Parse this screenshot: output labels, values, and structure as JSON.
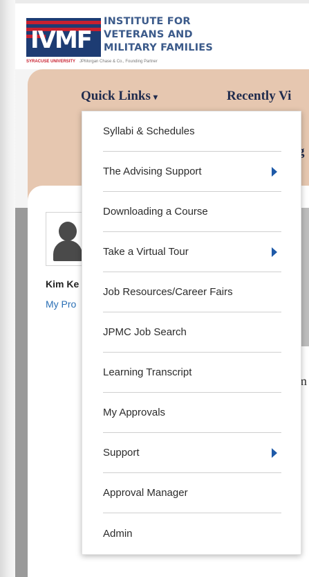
{
  "logo": {
    "mark_text": "IVMF",
    "name_line1": "INSTITUTE FOR",
    "name_line2": "VETERANS AND",
    "name_line3": "MILITARY FAMILIES",
    "footer_university": "SYRACUSE UNIVERSITY",
    "footer_partner": "JPMorgan Chase & Co., Founding Partner",
    "colors": {
      "navy": "#1d3c73",
      "red": "#c8202f"
    }
  },
  "nav": {
    "quick_links": "Quick Links",
    "quick_links_caret": "▾",
    "recently_viewed": "Recently Vi",
    "partial_second_row": "g",
    "bg_color": "#e6c7b0"
  },
  "profile": {
    "name": "Kim Ke",
    "link": "My Pro",
    "icon": "user-silhouette-icon"
  },
  "background_peek": "m",
  "menu": {
    "items": [
      {
        "label": "Syllabi & Schedules",
        "submenu": false
      },
      {
        "label": "The Advising Support",
        "submenu": true
      },
      {
        "label": "Downloading a Course",
        "submenu": false
      },
      {
        "label": "Take a Virtual Tour",
        "submenu": true
      },
      {
        "label": "Job Resources/Career Fairs",
        "submenu": false
      },
      {
        "label": "JPMC Job Search",
        "submenu": false
      },
      {
        "label": "Learning Transcript",
        "submenu": false
      },
      {
        "label": "My Approvals",
        "submenu": false
      },
      {
        "label": "Support",
        "submenu": true
      },
      {
        "label": "Approval Manager",
        "submenu": false
      },
      {
        "label": "Admin",
        "submenu": false
      }
    ],
    "chevron_color": "#1e5aa8"
  }
}
